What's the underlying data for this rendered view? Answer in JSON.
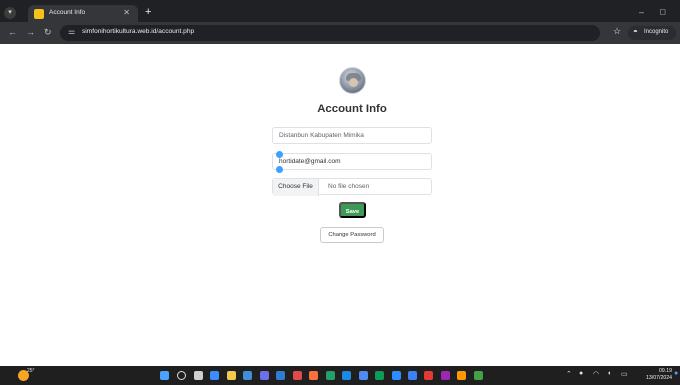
{
  "browser": {
    "tab_title": "Account Info",
    "url": "simfonihortikultura.web.id/account.php",
    "incognito_label": "Incognito",
    "icons": {
      "menu": "tab-menu-icon",
      "close": "close-icon",
      "new_tab": "plus-icon",
      "minimize": "minimize-icon",
      "maximize": "maximize-icon",
      "back": "back-arrow-icon",
      "forward": "forward-arrow-icon",
      "reload": "reload-icon",
      "site_info": "tune-icon",
      "bookmark": "star-icon",
      "incognito": "incognito-icon"
    }
  },
  "page": {
    "title": "Account Info",
    "name_value": "Distanbun Kabupaten Mimika",
    "email_value": "hortidate@gmail.com",
    "file_button": "Choose File",
    "file_status": "No file chosen",
    "save_label": "Save",
    "change_password_label": "Change Password",
    "accent_color": "#3c9a57"
  },
  "taskbar": {
    "weather_text": "25°",
    "time": "09.19",
    "date": "13/07/2024"
  }
}
